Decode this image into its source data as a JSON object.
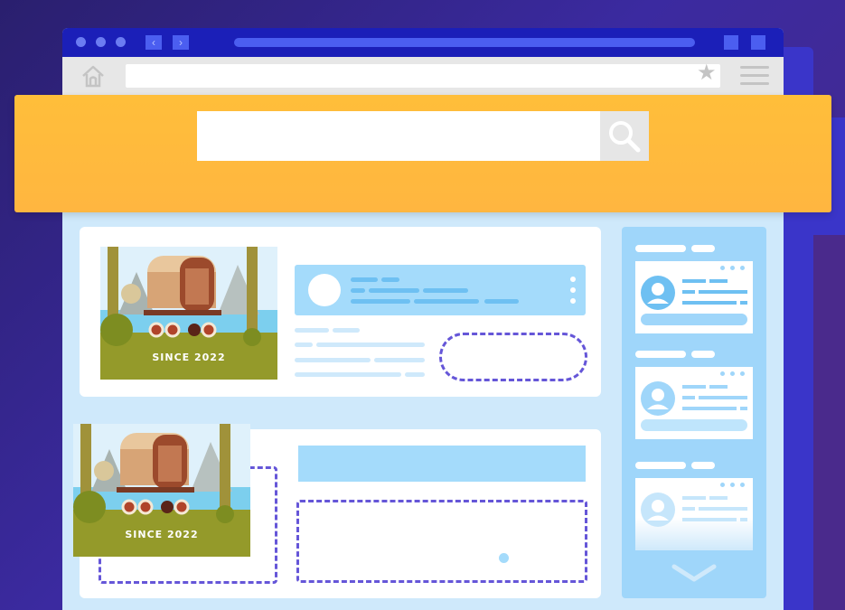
{
  "banner": {
    "search_placeholder": "",
    "search_value": "",
    "search_icon": "search-icon"
  },
  "browser": {
    "address_value": "",
    "icons": [
      "home-icon",
      "star-icon",
      "menu-icon",
      "back-icon",
      "forward-icon"
    ]
  },
  "cards": [
    {
      "photo_caption": "SINCE 2022"
    },
    {
      "photo_caption": "SINCE 2022"
    }
  ],
  "colors": {
    "banner": "#ffbe3a",
    "titlebar": "#1b1fb8",
    "accent_blue": "#a4dbfb",
    "dashed": "#6556d8",
    "page_bg": "#cfe9fb"
  }
}
